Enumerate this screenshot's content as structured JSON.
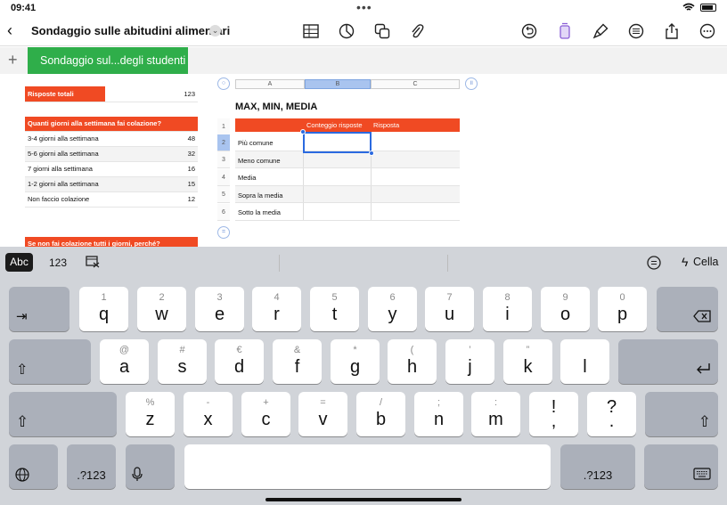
{
  "status": {
    "time": "09:41"
  },
  "toolbar": {
    "title": "Sondaggio sulle abitudini alimentari",
    "icons": [
      "table-icon",
      "chart-icon",
      "shapes-icon",
      "paperclip-icon",
      "undo-icon",
      "format-icon",
      "paintbrush-icon",
      "filter-icon",
      "share-icon",
      "more-icon"
    ]
  },
  "sheet_tab": {
    "active_label": "Sondaggio sul...degli studenti"
  },
  "left": {
    "total_label": "Risposte totali",
    "total_value": "123",
    "q1_header": "Quanti giorni alla settimana fai colazione?",
    "q1_rows": [
      {
        "label": "3-4 giorni alla settimana",
        "value": "48"
      },
      {
        "label": "5-6 giorni alla settimana",
        "value": "32"
      },
      {
        "label": "7 giorni alla settimana",
        "value": "16"
      },
      {
        "label": "1-2 giorni alla settimana",
        "value": "15"
      },
      {
        "label": "Non faccio colazione",
        "value": "12"
      }
    ],
    "q2_header": "Se non fai colazione tutti i giorni, perché?"
  },
  "right": {
    "columns": [
      "A",
      "B",
      "C"
    ],
    "title": "MAX, MIN, MEDIA",
    "header": {
      "count": "Conteggio risposte",
      "answer": "Risposta"
    },
    "row_numbers": [
      "1",
      "2",
      "3",
      "4",
      "5",
      "6"
    ],
    "rows": [
      "Più comune",
      "Meno comune",
      "Media",
      "Sopra la media",
      "Sotto la media"
    ]
  },
  "keyboard": {
    "suggestion_abc": "Abc",
    "suggestion_123": "123",
    "cell_label": "Cella",
    "row1": [
      {
        "sub": "1",
        "main": "q"
      },
      {
        "sub": "2",
        "main": "w"
      },
      {
        "sub": "3",
        "main": "e"
      },
      {
        "sub": "4",
        "main": "r"
      },
      {
        "sub": "5",
        "main": "t"
      },
      {
        "sub": "6",
        "main": "y"
      },
      {
        "sub": "7",
        "main": "u"
      },
      {
        "sub": "8",
        "main": "i"
      },
      {
        "sub": "9",
        "main": "o"
      },
      {
        "sub": "0",
        "main": "p"
      }
    ],
    "row2": [
      {
        "sub": "@",
        "main": "a"
      },
      {
        "sub": "#",
        "main": "s"
      },
      {
        "sub": "€",
        "main": "d"
      },
      {
        "sub": "&",
        "main": "f"
      },
      {
        "sub": "*",
        "main": "g"
      },
      {
        "sub": "(",
        "main": "h"
      },
      {
        "sub": "’",
        "main": "j"
      },
      {
        "sub": "”",
        "main": "k"
      },
      {
        "sub": "",
        "main": "l"
      }
    ],
    "row3": [
      {
        "sub": "%",
        "main": "z"
      },
      {
        "sub": "-",
        "main": "x"
      },
      {
        "sub": "+",
        "main": "c"
      },
      {
        "sub": "=",
        "main": "v"
      },
      {
        "sub": "/",
        "main": "b"
      },
      {
        "sub": ";",
        "main": "n"
      },
      {
        "sub": ":",
        "main": "m"
      },
      {
        "sub": "!",
        "main": ","
      },
      {
        "sub": "?",
        "main": "."
      }
    ],
    "numbers_label": ".?123"
  }
}
